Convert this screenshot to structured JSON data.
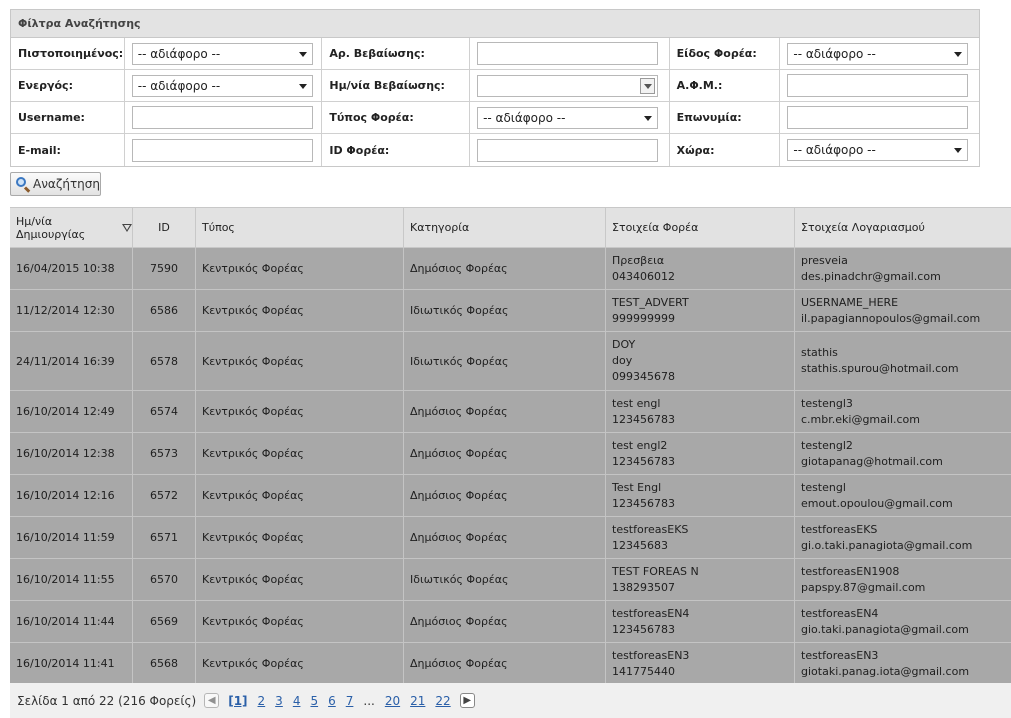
{
  "filters": {
    "title": "Φίλτρα Αναζήτησης",
    "rows": [
      [
        {
          "label": "Πιστοποιημένος:",
          "type": "select",
          "value": "-- αδιάφορο --"
        },
        {
          "label": "Αρ. Βεβαίωσης:",
          "type": "input",
          "value": ""
        },
        {
          "label": "Είδος Φορέα:",
          "type": "select",
          "value": "-- αδιάφορο --"
        }
      ],
      [
        {
          "label": "Ενεργός:",
          "type": "select",
          "value": "-- αδιάφορο --"
        },
        {
          "label": "Ημ/νία Βεβαίωσης:",
          "type": "date",
          "value": ""
        },
        {
          "label": "Α.Φ.Μ.:",
          "type": "input",
          "value": ""
        }
      ],
      [
        {
          "label": "Username:",
          "type": "input",
          "value": ""
        },
        {
          "label": "Τύπος Φορέα:",
          "type": "select",
          "value": "-- αδιάφορο --"
        },
        {
          "label": "Επωνυμία:",
          "type": "input",
          "value": ""
        }
      ],
      [
        {
          "label": "E-mail:",
          "type": "input",
          "value": ""
        },
        {
          "label": "ID Φορέα:",
          "type": "input",
          "value": ""
        },
        {
          "label": "Χώρα:",
          "type": "select",
          "value": "-- αδιάφορο --"
        }
      ]
    ]
  },
  "search_button": {
    "label": "Αναζήτηση"
  },
  "table": {
    "columns": [
      "Ημ/νία Δημιουργίας",
      "ID",
      "Τύπος",
      "Κατηγορία",
      "Στοιχεία Φορέα",
      "Στοιχεία Λογαριασμού"
    ],
    "rows": [
      {
        "date": "16/04/2015 10:38",
        "id": "7590",
        "type": "Κεντρικός Φορέας",
        "category": "Δημόσιος Φορέας",
        "entity": [
          "Πρεσβεια",
          "043406012"
        ],
        "account": [
          "presveia",
          "des.pinadchr@gmail.com"
        ]
      },
      {
        "date": "11/12/2014 12:30",
        "id": "6586",
        "type": "Κεντρικός Φορέας",
        "category": "Ιδιωτικός Φορέας",
        "entity": [
          "TEST_ADVERT",
          "999999999"
        ],
        "account": [
          "USERNAME_HERE",
          "il.papagiannopoulos@gmail.com"
        ]
      },
      {
        "date": "24/11/2014 16:39",
        "id": "6578",
        "type": "Κεντρικός Φορέας",
        "category": "Ιδιωτικός Φορέας",
        "entity": [
          "DOY",
          "doy",
          "099345678"
        ],
        "account": [
          "stathis",
          "stathis.spurou@hotmail.com"
        ]
      },
      {
        "date": "16/10/2014 12:49",
        "id": "6574",
        "type": "Κεντρικός Φορέας",
        "category": "Δημόσιος Φορέας",
        "entity": [
          "test engl",
          "123456783"
        ],
        "account": [
          "testengl3",
          "c.mbr.eki@gmail.com"
        ]
      },
      {
        "date": "16/10/2014 12:38",
        "id": "6573",
        "type": "Κεντρικός Φορέας",
        "category": "Δημόσιος Φορέας",
        "entity": [
          "test engl2",
          "123456783"
        ],
        "account": [
          "testengl2",
          "giotapanag@hotmail.com"
        ]
      },
      {
        "date": "16/10/2014 12:16",
        "id": "6572",
        "type": "Κεντρικός Φορέας",
        "category": "Δημόσιος Φορέας",
        "entity": [
          "Test Engl",
          "123456783"
        ],
        "account": [
          "testengl",
          "emout.opoulou@gmail.com"
        ]
      },
      {
        "date": "16/10/2014 11:59",
        "id": "6571",
        "type": "Κεντρικός Φορέας",
        "category": "Δημόσιος Φορέας",
        "entity": [
          "testforeasEKS",
          "12345683"
        ],
        "account": [
          "testforeasEKS",
          "gi.o.taki.panagiota@gmail.com"
        ]
      },
      {
        "date": "16/10/2014 11:55",
        "id": "6570",
        "type": "Κεντρικός Φορέας",
        "category": "Ιδιωτικός Φορέας",
        "entity": [
          "TEST FOREAS N",
          "138293507"
        ],
        "account": [
          "testforeasEN1908",
          "papspy.87@gmail.com"
        ]
      },
      {
        "date": "16/10/2014 11:44",
        "id": "6569",
        "type": "Κεντρικός Φορέας",
        "category": "Δημόσιος Φορέας",
        "entity": [
          "testforeasEN4",
          "123456783"
        ],
        "account": [
          "testforeasEN4",
          "gio.taki.panagiota@gmail.com"
        ]
      },
      {
        "date": "16/10/2014 11:41",
        "id": "6568",
        "type": "Κεντρικός Φορέας",
        "category": "Δημόσιος Φορέας",
        "entity": [
          "testforeasEN3",
          "141775440"
        ],
        "account": [
          "testforeasEN3",
          "giotaki.panag.iota@gmail.com"
        ]
      }
    ]
  },
  "pager": {
    "summary": "Σελίδα 1 από 22 (216 Φορείς)",
    "pages": [
      "[1]",
      "2",
      "3",
      "4",
      "5",
      "6",
      "7",
      "...",
      "20",
      "21",
      "22"
    ],
    "current": "[1]"
  },
  "colors": {
    "header_bg": "#e3e3e3",
    "row_bg": "#a8a8a8",
    "link": "#2a5fa8"
  }
}
